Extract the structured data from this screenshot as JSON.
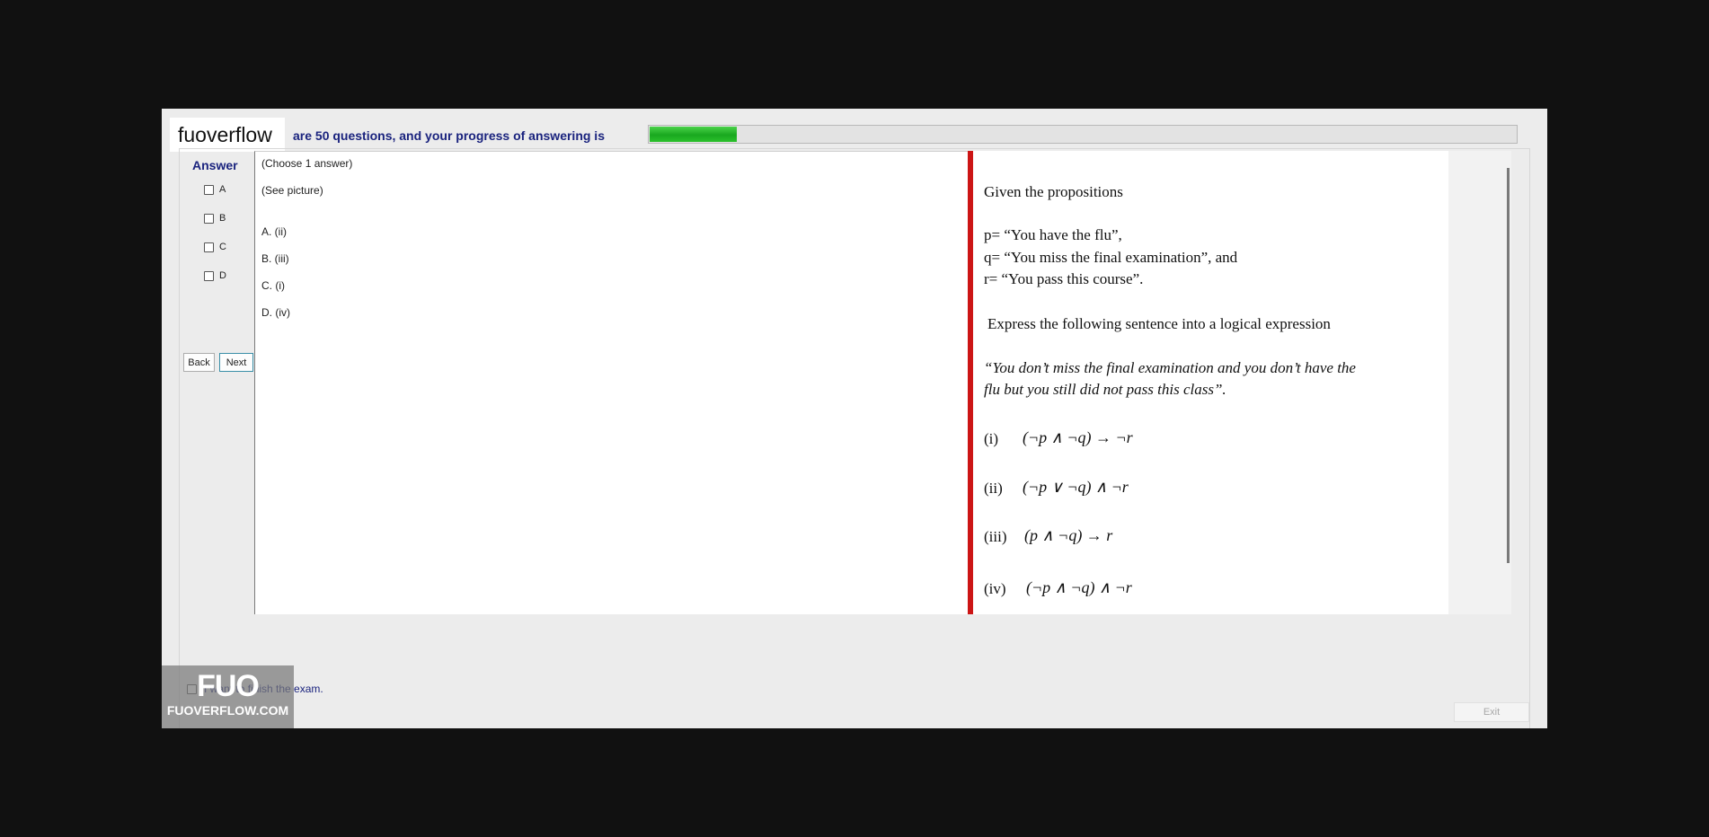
{
  "brand": "fuoverflow",
  "progress": {
    "label": "are 50 questions, and your progress of answering is",
    "value": 0.1
  },
  "answer_panel": {
    "title": "Answer",
    "options": [
      "A",
      "B",
      "C",
      "D"
    ]
  },
  "nav": {
    "back": "Back",
    "next": "Next"
  },
  "question": {
    "instruction": "(Choose 1 answer)",
    "note": "(See picture)",
    "choices": [
      "A.  (ii)",
      "B.  (iii)",
      "C.  (i)",
      "D.  (iv)"
    ]
  },
  "picture": {
    "intro": "Given the propositions",
    "p": "p= “You have the flu”,",
    "q": "q= “You miss the final examination”, and",
    "r": "r= “You pass this course”.",
    "task": "Express the following sentence into a logical expression",
    "quote_line1": "“You don’t miss the final examination and you don’t have the",
    "quote_line2": "flu but you still did  not pass this class”.",
    "items": [
      {
        "label": "(i)",
        "expr": "(¬p ∧ ¬q) → ¬r"
      },
      {
        "label": "(ii)",
        "expr": "(¬p ∨ ¬q) ∧ ¬r"
      },
      {
        "label": "(iii)",
        "expr": "(p ∧ ¬q) → r"
      },
      {
        "label": "(iv)",
        "expr": "(¬p ∧ ¬q) ∧ ¬r"
      }
    ]
  },
  "finish_label": "I want to finish the exam.",
  "logo": {
    "big": "FUO",
    "small": "FUOVERFLOW.COM"
  },
  "exit": "Exit",
  "colors": {
    "accent_red": "#cc1515",
    "progress_green": "#22b022",
    "label_navy": "#1a237e"
  }
}
